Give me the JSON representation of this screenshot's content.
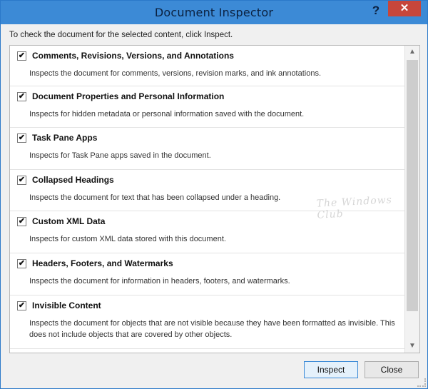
{
  "window": {
    "title": "Document Inspector",
    "help_label": "?",
    "close_label": "✕"
  },
  "instruction": "To check the document for the selected content, click Inspect.",
  "items": [
    {
      "label": "Comments, Revisions, Versions, and Annotations",
      "desc": "Inspects the document for comments, versions, revision marks, and ink annotations.",
      "checked": true
    },
    {
      "label": "Document Properties and Personal Information",
      "desc": "Inspects for hidden metadata or personal information saved with the document.",
      "checked": true
    },
    {
      "label": "Task Pane Apps",
      "desc": "Inspects for Task Pane apps saved in the document.",
      "checked": true
    },
    {
      "label": "Collapsed Headings",
      "desc": "Inspects the document for text that has been collapsed under a heading.",
      "checked": true
    },
    {
      "label": "Custom XML Data",
      "desc": "Inspects for custom XML data stored with this document.",
      "checked": true
    },
    {
      "label": "Headers, Footers, and Watermarks",
      "desc": "Inspects the document for information in headers, footers, and watermarks.",
      "checked": true
    },
    {
      "label": "Invisible Content",
      "desc": "Inspects the document for objects that are not visible because they have been formatted as invisible. This does not include objects that are covered by other objects.",
      "checked": true
    }
  ],
  "watermark_text": "The Windows Club",
  "buttons": {
    "inspect": "Inspect",
    "close": "Close"
  },
  "icons": {
    "check": "✔",
    "scroll_up": "▲",
    "scroll_down": "▼"
  }
}
